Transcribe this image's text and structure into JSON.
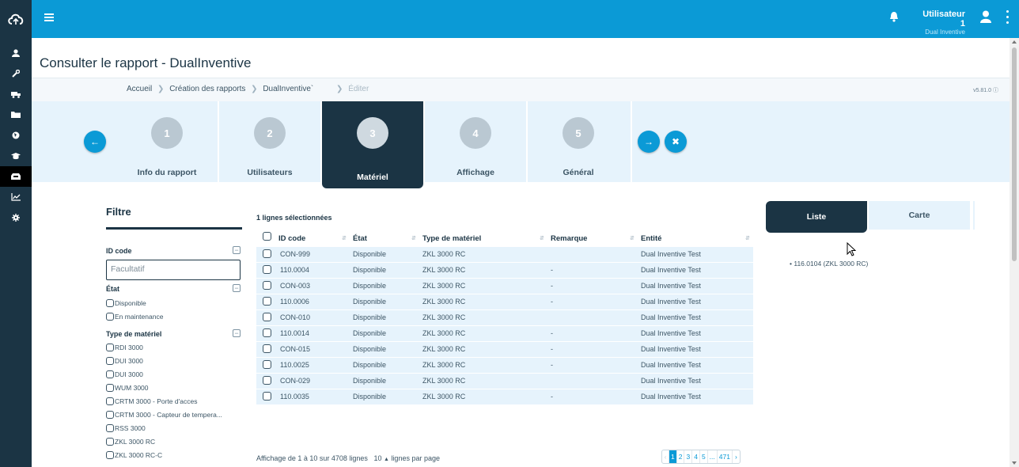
{
  "header": {
    "menu_icon": "hamburger-menu-icon",
    "user_name": "Utilisateur 1",
    "user_sub": "Dual Inventive"
  },
  "sidebar": {
    "items": [
      {
        "icon": "user-icon"
      },
      {
        "icon": "wrench-icon"
      },
      {
        "icon": "truck-icon"
      },
      {
        "icon": "folder-icon"
      },
      {
        "icon": "globe-icon"
      },
      {
        "icon": "graduation-cap-icon"
      },
      {
        "icon": "inbox-icon",
        "active": true
      },
      {
        "icon": "line-chart-icon"
      },
      {
        "icon": "gear-icon"
      }
    ]
  },
  "page": {
    "title": "Consulter le rapport - DualInventive",
    "breadcrumb": [
      "Accueil",
      "Création des rapports",
      "DualInventive`",
      "Éditer"
    ],
    "version": "v5.81.0"
  },
  "steps": [
    {
      "number": "1",
      "label": "Info du rapport"
    },
    {
      "number": "2",
      "label": "Utilisateurs"
    },
    {
      "number": "3",
      "label": "Matériel",
      "active": true
    },
    {
      "number": "4",
      "label": "Affichage"
    },
    {
      "number": "5",
      "label": "Général"
    }
  ],
  "filter": {
    "title": "Filtre",
    "id_code_label": "ID code",
    "id_code_placeholder": "Facultatif",
    "state_label": "État",
    "states": [
      "Disponible",
      "En maintenance"
    ],
    "type_label": "Type de matériel",
    "types": [
      "RDI 3000",
      "DUI 3000",
      "DUI 3000",
      "WUM 3000",
      "CRTM 3000 - Porte d'acces",
      "CRTM 3000 - Capteur de tempera...",
      "RSS 3000",
      "ZKL 3000 RC",
      "ZKL 3000 RC-C"
    ]
  },
  "table": {
    "selected_count": "1 lignes sélectionnées",
    "columns": [
      "ID code",
      "État",
      "Type de matériel",
      "Remarque",
      "Entité"
    ],
    "rows": [
      [
        "CON-999",
        "Disponible",
        "ZKL 3000 RC",
        "",
        "Dual Inventive Test"
      ],
      [
        "110.0004",
        "Disponible",
        "ZKL 3000 RC",
        "-",
        "Dual Inventive Test"
      ],
      [
        "CON-003",
        "Disponible",
        "ZKL 3000 RC",
        "-",
        "Dual Inventive Test"
      ],
      [
        "110.0006",
        "Disponible",
        "ZKL 3000 RC",
        "-",
        "Dual Inventive Test"
      ],
      [
        "CON-010",
        "Disponible",
        "ZKL 3000 RC",
        "",
        "Dual Inventive Test"
      ],
      [
        "110.0014",
        "Disponible",
        "ZKL 3000 RC",
        "-",
        "Dual Inventive Test"
      ],
      [
        "CON-015",
        "Disponible",
        "ZKL 3000 RC",
        "-",
        "Dual Inventive Test"
      ],
      [
        "110.0025",
        "Disponible",
        "ZKL 3000 RC",
        "-",
        "Dual Inventive Test"
      ],
      [
        "CON-029",
        "Disponible",
        "ZKL 3000 RC",
        "",
        "Dual Inventive Test"
      ],
      [
        "110.0035",
        "Disponible",
        "ZKL 3000 RC",
        "-",
        "Dual Inventive Test"
      ]
    ],
    "footer_info": "Affichage de 1 à 10 sur 4708 lignes",
    "page_size": "10",
    "page_size_suffix": "lignes par page",
    "pages": [
      "‹",
      "1",
      "2",
      "3",
      "4",
      "5",
      "...",
      "471",
      "›"
    ]
  },
  "right_panel": {
    "tabs": [
      "Liste",
      "Carte"
    ],
    "items": [
      "116.0104 (ZKL 3000 RC)"
    ]
  },
  "colors": {
    "brand_blue": "#0b9ad6",
    "dark_navy": "#1b3444",
    "light_row": "#e6f3fc"
  }
}
